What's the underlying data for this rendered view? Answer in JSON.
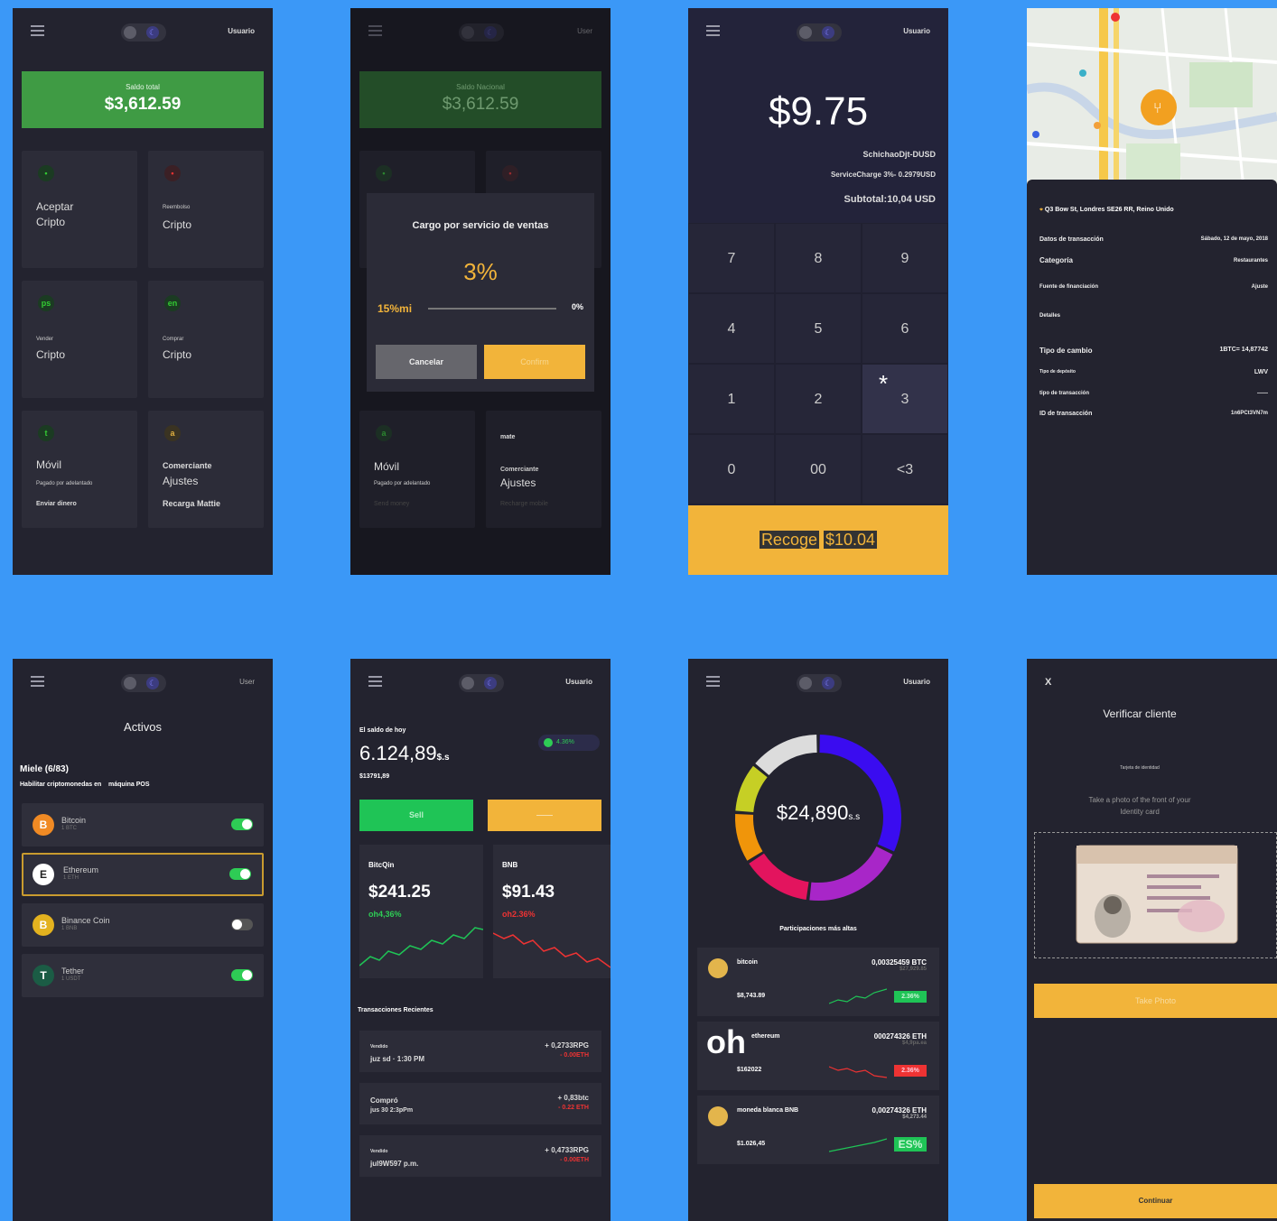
{
  "colors": {
    "background": "#3b98f7",
    "accent": "#f2b43a",
    "green": "#3f9b44",
    "panel": "#23232f"
  },
  "screen1": {
    "user": "Usuario",
    "balance_label": "Saldo total",
    "balance": "$3,612.59",
    "tiles": [
      {
        "icon": "green-dot-icon",
        "big": "Aceptar\nCripto"
      },
      {
        "icon": "red-dot-icon",
        "small": "Reembolso",
        "big": "Cripto"
      },
      {
        "icon_text": "ps",
        "small": "Vender",
        "big": "Cripto"
      },
      {
        "icon_text": "en",
        "small": "Comprar",
        "big": "Cripto"
      },
      {
        "icon_text": "t",
        "big": "Móvil",
        "small1": "Pagado por adelantado",
        "bold2": "Enviar dinero"
      },
      {
        "icon_text": "a",
        "bold1": "Comerciante",
        "big": "Ajustes",
        "bold2": "Recarga Mattie"
      }
    ]
  },
  "screen2": {
    "user": "User",
    "balance_label": "Saldo Nacional",
    "balance": "$3,612.59",
    "modal_title": "Cargo por servicio de ventas",
    "modal_pct": "3%",
    "range_left": "15%",
    "range_left_accent": "mi",
    "range_right": "0%",
    "cancel": "Cancelar",
    "confirm": "Confirm",
    "tile_left_icon": "a",
    "tile_left_big": "Móvil",
    "tile_left_small": "Pagado por adelantado",
    "tile_left_faded": "Send money",
    "tile_right_top": "mate",
    "tile_right_small": "Comerciante",
    "tile_right_big": "Ajustes",
    "tile_right_faded": "Recharge mobile"
  },
  "screen3": {
    "user": "Usuario",
    "amount": "$9.75",
    "line1": "SchichaoDjt-DUSD",
    "line2": "ServiceCharge 3%- 0.2979USD",
    "line3": "Subtotal:10,04 USD",
    "keys": [
      "7",
      "8",
      "9",
      "4",
      "5",
      "6",
      "1",
      "2",
      "3",
      "0",
      "00",
      "<3"
    ],
    "key_star": "*",
    "pickup_label": "Recoge",
    "pickup_amount": "$10.04"
  },
  "screen4": {
    "address": "Q3 Bow St, Londres SE26 RR, Reino Unido",
    "rows": [
      {
        "k": "Datos de transacción",
        "v": "Sábado, 12 de mayo, 2018"
      },
      {
        "k": "Categoría",
        "v": "Restaurantes"
      },
      {
        "k": "Fuente de financiación",
        "v": "Ajuste"
      },
      {
        "k": "Detalles",
        "v": ""
      },
      {
        "k": "Tipo de cambio",
        "v": "1BTC= 14,87742"
      },
      {
        "k": "Tipo de depósito",
        "v": "LWV"
      },
      {
        "k": "tipo de transacción",
        "v": "——"
      },
      {
        "k": "ID de transacción",
        "v": "1n6PCt3VN7m"
      }
    ]
  },
  "screen5": {
    "user": "User",
    "title": "Activos",
    "subtitle": "Miele (6/83)",
    "subtitle2": "Habilitar criptomonedas en    máquina POS",
    "coins": [
      {
        "name": "Bitcoin",
        "sym": "1 BTC",
        "icon": "B",
        "on": true
      },
      {
        "name": "Ethereum",
        "sym": "1 ETH",
        "icon": "E",
        "on": true
      },
      {
        "name": "Binance Coin",
        "sym": "1 BNB",
        "icon": "B",
        "on": false
      },
      {
        "name": "Tether",
        "sym": "1 USDT",
        "icon": "T",
        "on": true
      }
    ]
  },
  "screen6": {
    "user": "Usuario",
    "label": "El saldo de hoy",
    "balance": "6.124,89",
    "balance_unit": "$.s",
    "sub": "$13791,89",
    "badge": "4.36%",
    "sell": "Sell",
    "buy": "——",
    "cards": [
      {
        "name": "BitcQin",
        "value": "$241.25",
        "pct": "oh4,36%"
      },
      {
        "name": "BNB",
        "value": "$91.43",
        "pct": "oh2.36%"
      }
    ],
    "recent": "Transacciones Recientes",
    "txs": [
      {
        "a": "Vendido",
        "b": "juz sd · 1:30 PM",
        "c": "+ 0,2733RPG",
        "d": "- 0.00ETH"
      },
      {
        "a": "Compró",
        "b": "jus 30 2:3pPm",
        "c": "+ 0,83btc",
        "d": "- 0.22 ETH"
      },
      {
        "a": "Vendido",
        "b": "jul9W597 p.m.",
        "c": "+ 0,4733RPG",
        "d": "- 0.00ETH"
      }
    ]
  },
  "screen7": {
    "user": "Usuario",
    "total": "$24,890",
    "total_unit": "s.s",
    "caption": "Participaciones más altas",
    "donut_slices": [
      {
        "name": "purple-blue",
        "value": 32,
        "color": "#3a0cf0"
      },
      {
        "name": "violet",
        "value": 20,
        "color": "#a826c8"
      },
      {
        "name": "pink",
        "value": 14,
        "color": "#e3145e"
      },
      {
        "name": "orange",
        "value": 10,
        "color": "#f0950a"
      },
      {
        "name": "lime",
        "value": 10,
        "color": "#c6cf25"
      },
      {
        "name": "grey",
        "value": 14,
        "color": "#dcdcdc"
      }
    ],
    "holdings": [
      {
        "name": "bitcoin",
        "qty": "0,00325459 BTC",
        "sub": "$27,929.85",
        "fiat": "$8,743.89",
        "chg": "2.36%",
        "up": true
      },
      {
        "name": "ethereum",
        "overlay": "oh",
        "qty": "000274326 ETH",
        "sub": "$4,9pa.ea",
        "fiat": "$162022",
        "chg": "2.36%",
        "up": false
      },
      {
        "name": "moneda blanca BNB",
        "qty": "0,00274326 ETH",
        "sub": "$4,273.44",
        "fiat": "$1.026,45",
        "chg": "ES%",
        "up": true
      }
    ]
  },
  "screen8": {
    "close": "X",
    "title": "Verificar cliente",
    "subtitle": "Tarjeta de identidad",
    "instruction": "Take a photo of the front of your Identity card",
    "take_photo": "Take Photo",
    "continue": "Continuar"
  }
}
